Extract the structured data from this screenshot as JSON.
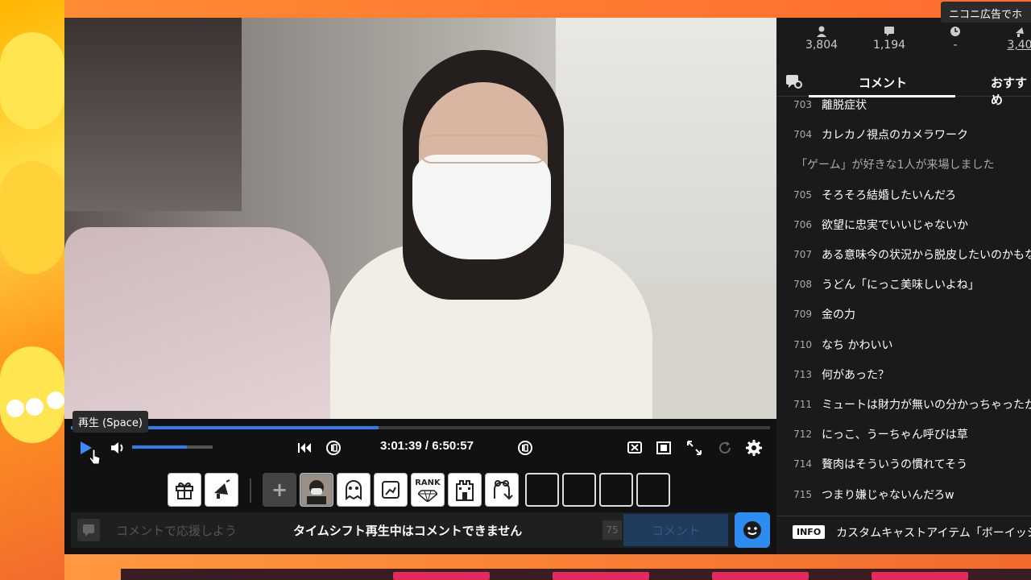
{
  "tooltip_play": "再生 (Space)",
  "player": {
    "time_current": "3:01:39",
    "time_sep": " / ",
    "time_total": "6:50:57",
    "seek_progress": 0.44,
    "volume_level": 0.68
  },
  "items": [
    {
      "type": "gift"
    },
    {
      "type": "nicoad"
    },
    {
      "type": "plus",
      "label": "+"
    },
    {
      "type": "avatar"
    },
    {
      "type": "ghost"
    },
    {
      "type": "frame"
    },
    {
      "type": "rank",
      "label": "RANK"
    },
    {
      "type": "castle"
    },
    {
      "type": "bear"
    },
    {
      "type": "empty"
    },
    {
      "type": "empty"
    },
    {
      "type": "empty"
    },
    {
      "type": "empty"
    }
  ],
  "commentbar": {
    "placeholder": "コメントで応援しよう",
    "notice": "タイムシフト再生中はコメントできません",
    "char_count": "75",
    "submit_label": "コメント"
  },
  "panel": {
    "stats": [
      {
        "icon": "user-icon",
        "value": "3,804"
      },
      {
        "icon": "comment-icon",
        "value": "1,194"
      },
      {
        "icon": "clock-icon",
        "value": "-"
      },
      {
        "icon": "ad-icon",
        "value": "3,40"
      }
    ],
    "top_tooltip": "ニコニ広告でホ",
    "tabs": [
      {
        "label": "コメント",
        "active": true
      },
      {
        "label": "おすすめ",
        "active": false
      }
    ],
    "comments": [
      {
        "num": "703",
        "text": "離脱症状"
      },
      {
        "num": "704",
        "text": "カレカノ視点のカメラワーク"
      },
      {
        "num": "",
        "text": "「ゲーム」が好きな1人が来場しました",
        "system": true
      },
      {
        "num": "705",
        "text": "そろそろ結婚したいんだろ"
      },
      {
        "num": "706",
        "text": "欲望に忠実でいいじゃないか"
      },
      {
        "num": "707",
        "text": "ある意味今の状況から脱皮したいのかもな"
      },
      {
        "num": "708",
        "text": "うどん「にっこ美味しいよね」"
      },
      {
        "num": "709",
        "text": "金の力"
      },
      {
        "num": "710",
        "text": "なち かわいい"
      },
      {
        "num": "713",
        "text": "何があった？"
      },
      {
        "num": "711",
        "text": "ミュートは財力が無いの分かっちゃったか"
      },
      {
        "num": "712",
        "text": "にっこ、うーちゃん呼びは草"
      },
      {
        "num": "714",
        "text": "贅肉はそういうの慣れてそう"
      },
      {
        "num": "715",
        "text": "つまり嫌じゃないんだろw"
      }
    ],
    "info_badge": "INFO",
    "info_text": "カスタムキャストアイテム「ボーイッシュ"
  },
  "colors": {
    "accent": "#2c7cf0",
    "panel_bg": "#1a1a1a",
    "player_bg": "#111111"
  }
}
